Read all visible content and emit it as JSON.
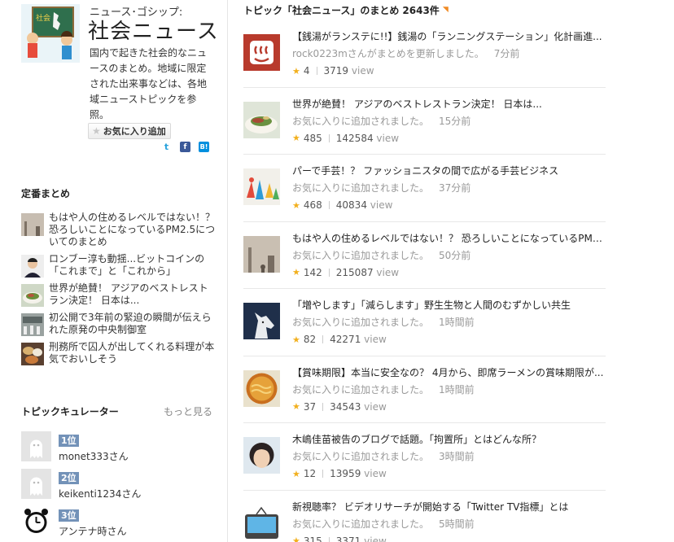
{
  "category": {
    "subtitle": "ニュース･ゴシップ:",
    "title": "社会ニュース",
    "hero_sign": "社会",
    "description": "国内で起きた社会的なニュースのまとめ。地域に限定された出来事などは、各地域ニューストピックを参照。",
    "favorite_label": "お気に入り追加",
    "share": {
      "twitter": "t",
      "facebook": "f",
      "hatena": "B!"
    }
  },
  "standard": {
    "title": "定番まとめ",
    "items": [
      {
        "text": "もはや人の住めるレベルではない！？ 恐ろしいことになっているPM2.5についてのまとめ"
      },
      {
        "text": "ロンブー淳も動揺...ビットコインの「これまで」と「これから」"
      },
      {
        "text": "世界が絶賛！ アジアのベストレストラン決定！ 日本は..."
      },
      {
        "text": "初公開で3年前の緊迫の瞬間が伝えられた原発の中央制御室"
      },
      {
        "text": "刑務所で囚人が出してくれる料理が本気でおいしそう"
      }
    ]
  },
  "curators": {
    "title": "トピックキュレーター",
    "more": "もっと見る",
    "items": [
      {
        "rank": "1位",
        "name": "monet333さん"
      },
      {
        "rank": "2位",
        "name": "keikenti1234さん"
      },
      {
        "rank": "3位",
        "name": "アンテナ時さん"
      }
    ]
  },
  "topics": {
    "heading": "トピック「社会ニュース」のまとめ",
    "count": "2643件",
    "items": [
      {
        "title": "【銭湯がランステに!!】銭湯の「ランニングステーション」化計画進...",
        "meta": "rock0223mさんがまとめを更新しました。",
        "time": "7分前",
        "favs": "4",
        "views": "3719",
        "view_unit": "view"
      },
      {
        "title": "世界が絶賛！ アジアのベストレストラン決定！ 日本は...",
        "meta": "お気に入りに追加されました。",
        "time": "15分前",
        "favs": "485",
        "views": "142584",
        "view_unit": "view"
      },
      {
        "title": "パーで手芸！？ ファッショニスタの間で広がる手芸ビジネス",
        "meta": "お気に入りに追加されました。",
        "time": "37分前",
        "favs": "468",
        "views": "40834",
        "view_unit": "view"
      },
      {
        "title": "もはや人の住めるレベルではない！？ 恐ろしいことになっているPM2...",
        "meta": "お気に入りに追加されました。",
        "time": "50分前",
        "favs": "142",
        "views": "215087",
        "view_unit": "view"
      },
      {
        "title": "「増やします」「減らします」野生生物と人間のむずかしい共生",
        "meta": "お気に入りに追加されました。",
        "time": "1時間前",
        "favs": "82",
        "views": "42271",
        "view_unit": "view"
      },
      {
        "title": "【賞味期限】本当に安全なの？ 4月から、即席ラーメンの賞味期限が...",
        "meta": "お気に入りに追加されました。",
        "time": "1時間前",
        "favs": "37",
        "views": "34543",
        "view_unit": "view"
      },
      {
        "title": "木嶋佳苗被告のブログで話題。「拘置所」とはどんな所？",
        "meta": "お気に入りに追加されました。",
        "time": "3時間前",
        "favs": "12",
        "views": "13959",
        "view_unit": "view"
      },
      {
        "title": "新視聴率？ ビデオリサーチが開始する「Twitter TV指標」とは",
        "meta": "お気に入りに追加されました。",
        "time": "5時間前",
        "favs": "315",
        "views": "3371",
        "view_unit": "view"
      }
    ]
  },
  "colors": {
    "rank_badge": "#7392b8",
    "star": "#f2b01e",
    "rss": "#f08a24"
  }
}
